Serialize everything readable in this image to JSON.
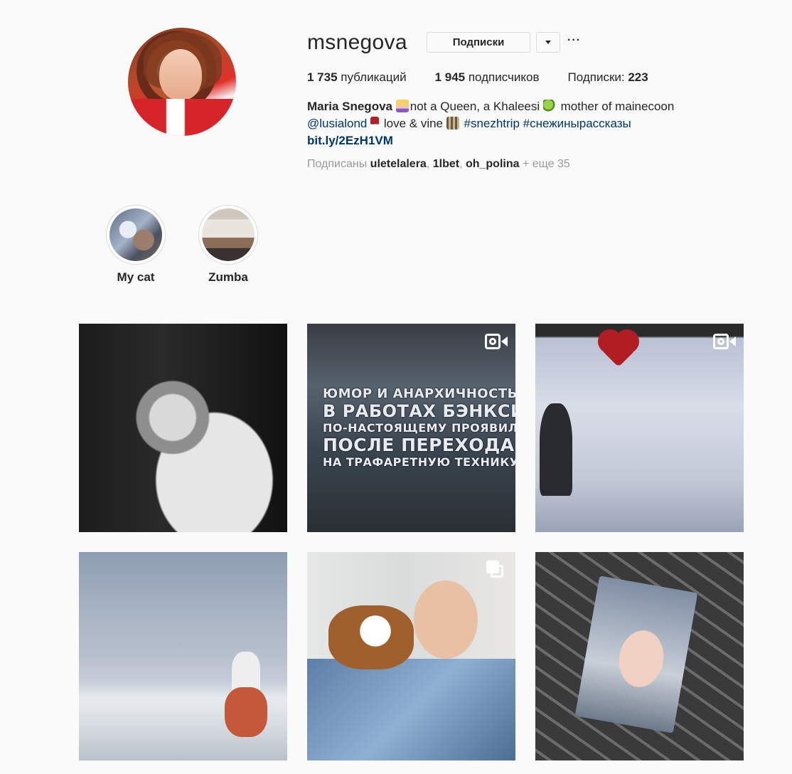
{
  "profile": {
    "username": "msnegova",
    "follow_button": "Подписки",
    "more_label": "···"
  },
  "stats": {
    "posts_count": "1 735",
    "posts_label": "публикаций",
    "followers_count": "1 945",
    "followers_label": "подписчиков",
    "following_label": "Подписки:",
    "following_count": "223"
  },
  "bio": {
    "name": "Maria Snegova",
    "line1_a": "not a Queen, a Khaleesi",
    "line1_b": "mother of mainecoon",
    "mention": "@lusialond",
    "love_vine": "love & vine",
    "tag1": "#snezhtrip",
    "tag2": "#снежинырассказы",
    "url": "bit.ly/2EzH1VM"
  },
  "followed_by": {
    "prefix": "Подписаны",
    "user1": "uletelalera",
    "user2": "1lbet",
    "user3": "oh_polina",
    "more": "+ еще 35"
  },
  "highlights": [
    {
      "label": "My cat"
    },
    {
      "label": "Zumba"
    }
  ],
  "posts": [
    {
      "type": "photo"
    },
    {
      "type": "video",
      "overlay_lines": [
        "ЮМОР И АНАРХИЧНОСТЬ",
        "В РАБОТАХ БЭНКСИ",
        "ПО-НАСТОЯЩЕМУ ПРОЯВИЛИСЬ",
        "ПОСЛЕ ПЕРЕХОДА",
        "НА ТРАФАРЕТНУЮ ТЕХНИКУ"
      ]
    },
    {
      "type": "video"
    },
    {
      "type": "photo"
    },
    {
      "type": "carousel"
    },
    {
      "type": "photo"
    }
  ]
}
